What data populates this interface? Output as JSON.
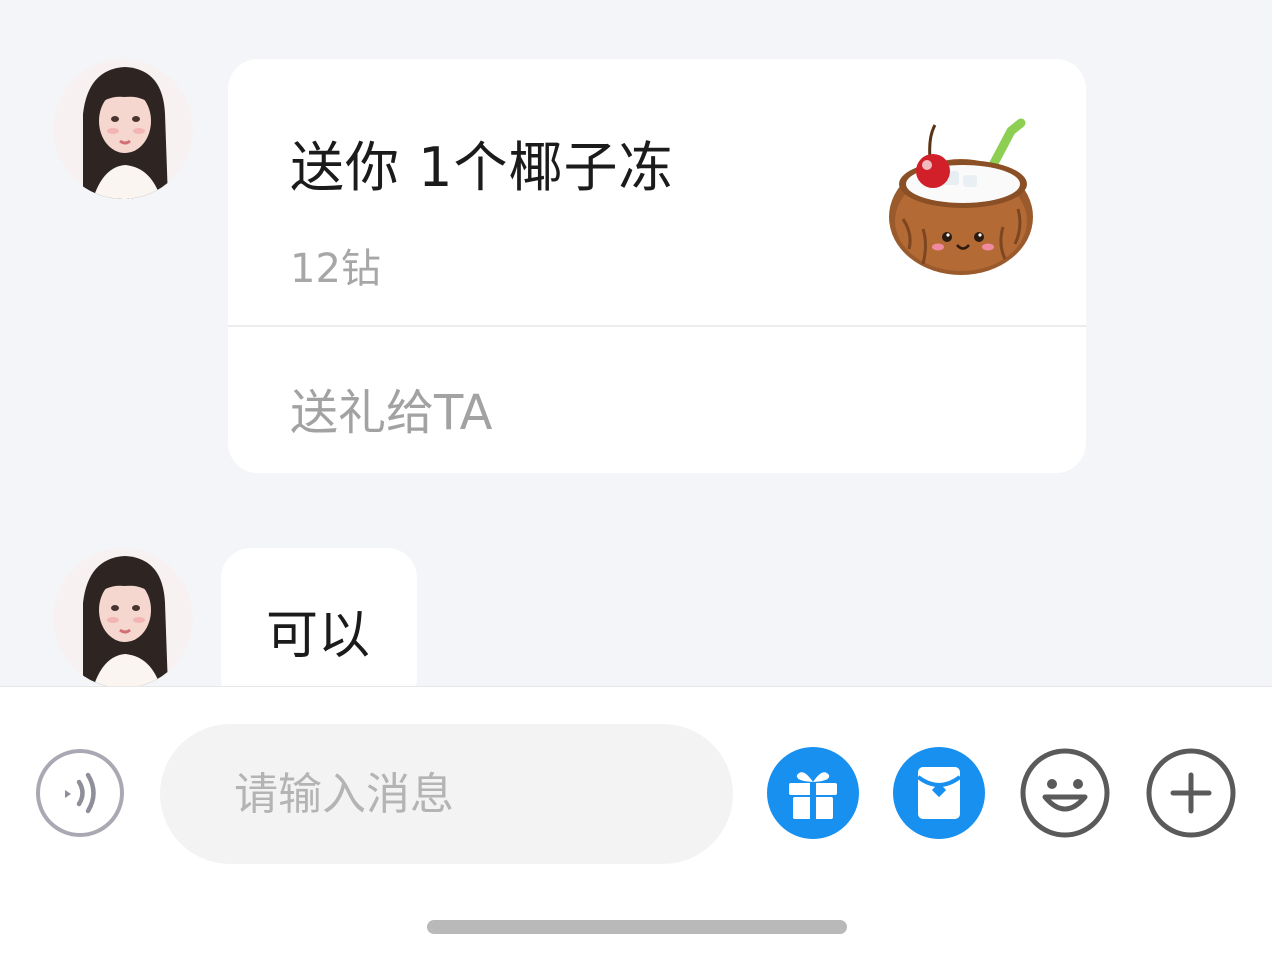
{
  "messages": [
    {
      "type": "gift",
      "sender_avatar": "user-avatar-photo",
      "title": "送你 1个椰子冻",
      "price": "12钻",
      "gift_icon": "coconut-jelly-icon",
      "action_label": "送礼给TA"
    },
    {
      "type": "text",
      "sender_avatar": "user-avatar-photo",
      "text": "可以"
    }
  ],
  "input_bar": {
    "placeholder": "请输入消息",
    "voice_icon": "voice-icon",
    "gift_icon": "gift-box-icon",
    "red_packet_icon": "red-packet-icon",
    "emoji_icon": "smiley-icon",
    "more_icon": "plus-icon"
  },
  "colors": {
    "chat_background": "#f3f5f8",
    "accent_blue": "#1890f0",
    "bubble_background": "#ffffff"
  }
}
